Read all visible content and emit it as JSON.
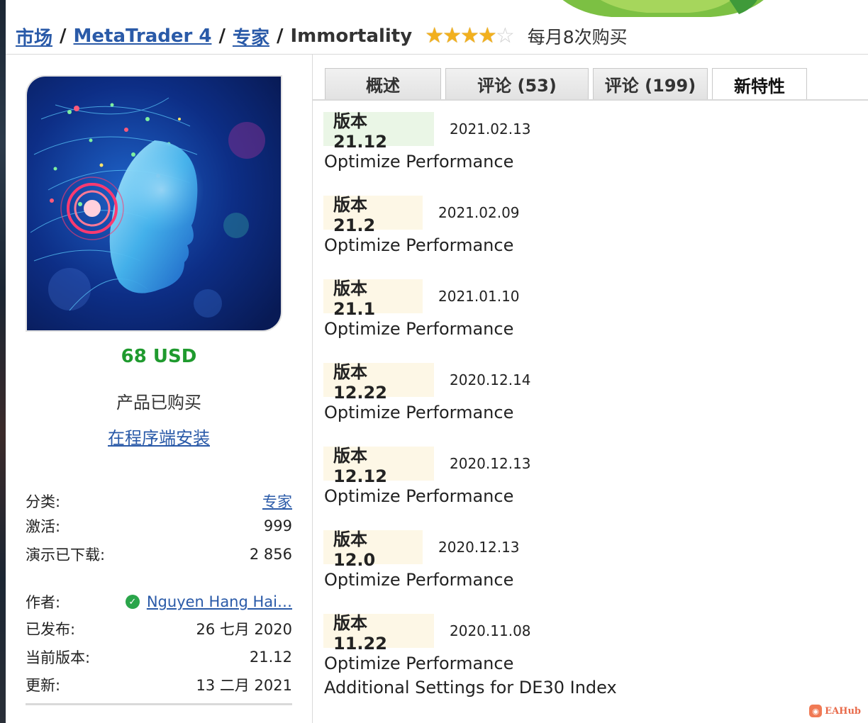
{
  "breadcrumb": {
    "items": [
      "市场",
      "MetaTrader 4",
      "专家"
    ],
    "separator": "/",
    "current": "Immortality",
    "rating": 4,
    "rating_max": 5,
    "purchases": "每月8次购买"
  },
  "product": {
    "price": "68 USD",
    "purchased_text": "产品已购买",
    "install_link": "在程序端安装"
  },
  "info": {
    "category_label": "分类:",
    "category_value": "专家",
    "activations_label": "激活:",
    "activations_value": "999",
    "demo_label": "演示已下载:",
    "demo_value": "2 856",
    "author_label": "作者:",
    "author_value": "Nguyen Hang Hai…",
    "published_label": "已发布:",
    "published_value": "26 七月 2020",
    "version_label": "当前版本:",
    "version_value": "21.12",
    "updated_label": "更新:",
    "updated_value": "13 二月 2021"
  },
  "tabs": [
    {
      "label": "概述",
      "active": false
    },
    {
      "label": "评论 (53)",
      "active": false
    },
    {
      "label": "评论 (199)",
      "active": false
    },
    {
      "label": "新特性",
      "active": true
    }
  ],
  "versions": [
    {
      "label": "版本 21.12",
      "date": "2021.02.13",
      "notes": [
        "Optimize Performance"
      ],
      "latest": true
    },
    {
      "label": "版本 21.2",
      "date": "2021.02.09",
      "notes": [
        "Optimize Performance"
      ],
      "latest": false
    },
    {
      "label": "版本 21.1",
      "date": "2021.01.10",
      "notes": [
        "Optimize Performance"
      ],
      "latest": false
    },
    {
      "label": "版本 12.22",
      "date": "2020.12.14",
      "notes": [
        "Optimize Performance"
      ],
      "latest": false
    },
    {
      "label": "版本 12.12",
      "date": "2020.12.13",
      "notes": [
        "Optimize Performance"
      ],
      "latest": false
    },
    {
      "label": "版本 12.0",
      "date": "2020.12.13",
      "notes": [
        "Optimize Performance"
      ],
      "latest": false
    },
    {
      "label": "版本 11.22",
      "date": "2020.11.08",
      "notes": [
        "Optimize Performance",
        "Additional Settings for DE30 Index"
      ],
      "latest": false
    }
  ],
  "watermark": "EAHub",
  "colors": {
    "link": "#2a5aa8",
    "price": "#1f9a2e",
    "star": "#f2b01e",
    "latest_badge": "#eaf6e6",
    "old_badge": "#fdf7e6"
  }
}
